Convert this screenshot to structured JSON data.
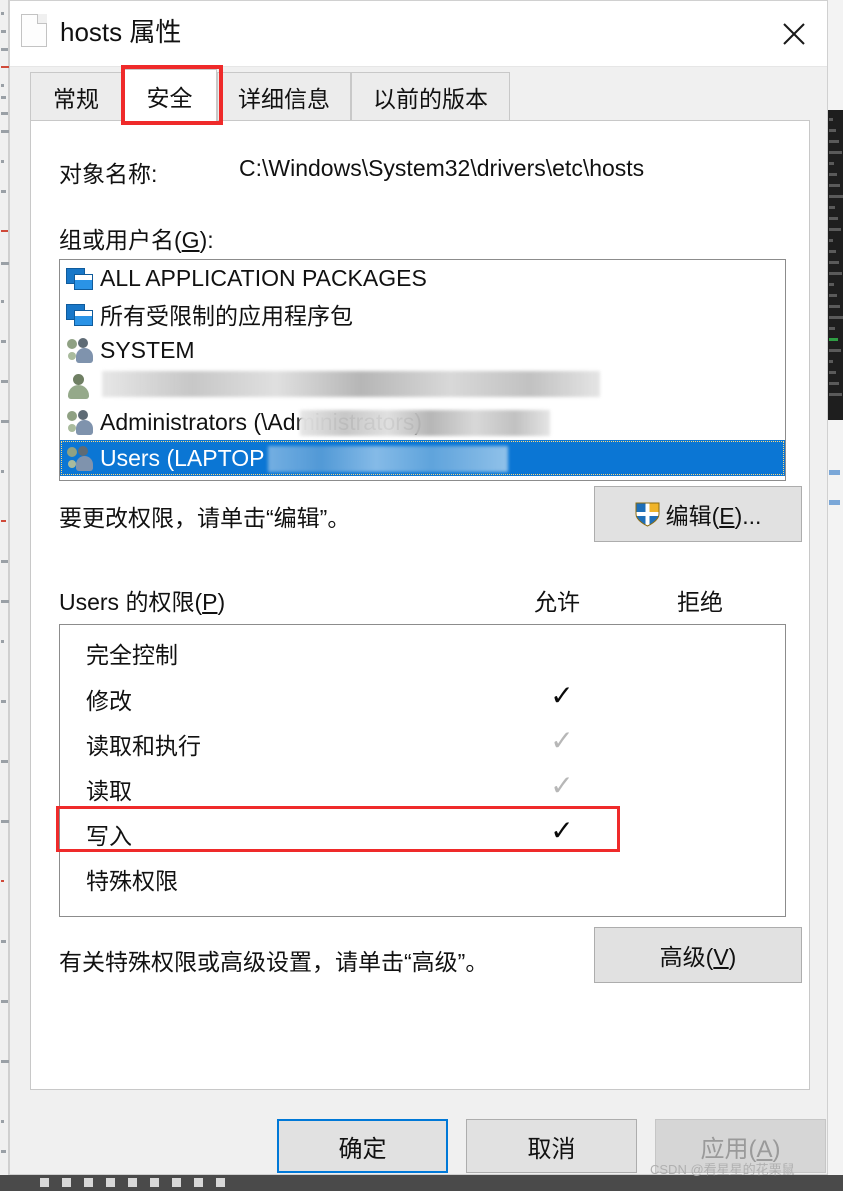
{
  "window": {
    "title": "hosts 属性",
    "file_icon": "file-document-icon",
    "close_icon": "close-icon"
  },
  "tabs": [
    {
      "label": "常规",
      "active": false
    },
    {
      "label": "安全",
      "active": true
    },
    {
      "label": "详细信息",
      "active": false
    },
    {
      "label": "以前的版本",
      "active": false
    }
  ],
  "security": {
    "object_name_label": "对象名称:",
    "object_name_value": "C:\\Windows\\System32\\drivers\\etc\\hosts",
    "groups_label_pre": "组或用户名(",
    "groups_label_key": "G",
    "groups_label_post": "):",
    "users": [
      {
        "name": "ALL APPLICATION PACKAGES",
        "icon": "package-icon",
        "selected": false,
        "redacted": false
      },
      {
        "name": "所有受限制的应用程序包",
        "icon": "package-icon",
        "selected": false,
        "redacted": false
      },
      {
        "name": "SYSTEM",
        "icon": "group-icon",
        "selected": false,
        "redacted": false
      },
      {
        "name": "",
        "icon": "person-icon",
        "selected": false,
        "redacted": true
      },
      {
        "name": "Administrators (",
        "name_tail": "\\Administrators)",
        "icon": "group-icon",
        "selected": false,
        "redacted": true
      },
      {
        "name": "Users (LAPTOP",
        "name_tail": "",
        "icon": "group-icon",
        "selected": true,
        "redacted": true
      }
    ],
    "edit_hint": "要更改权限，请单击“编辑”。",
    "edit_button_pre": "编辑(",
    "edit_button_key": "E",
    "edit_button_post": ")...",
    "edit_button_icon": "uac-shield-icon",
    "permissions_label_pre": "Users 的权限(",
    "permissions_label_key": "P",
    "permissions_label_post": ")",
    "allow_header": "允许",
    "deny_header": "拒绝",
    "permissions": [
      {
        "name": "完全控制",
        "allow": "none",
        "deny": "none",
        "highlighted": false
      },
      {
        "name": "修改",
        "allow": "on",
        "deny": "none",
        "highlighted": false
      },
      {
        "name": "读取和执行",
        "allow": "dim",
        "deny": "none",
        "highlighted": false
      },
      {
        "name": "读取",
        "allow": "dim",
        "deny": "none",
        "highlighted": false
      },
      {
        "name": "写入",
        "allow": "on",
        "deny": "none",
        "highlighted": true
      },
      {
        "name": "特殊权限",
        "allow": "none",
        "deny": "none",
        "highlighted": false
      }
    ],
    "check_glyph": "✓",
    "advanced_hint": "有关特殊权限或高级设置，请单击“高级”。",
    "advanced_button_pre": "高级(",
    "advanced_button_key": "V",
    "advanced_button_post": ")"
  },
  "footer": {
    "ok_label": "确定",
    "cancel_label": "取消",
    "apply_pre": "应用(",
    "apply_key": "A",
    "apply_post": ")"
  },
  "watermark": "CSDN @看星星的花栗鼠",
  "colors": {
    "selection_blue": "#0b76d4",
    "default_button_border": "#0078d7",
    "annotation_red": "#ef2a2a",
    "dialog_bg": "#f0f0f0"
  }
}
